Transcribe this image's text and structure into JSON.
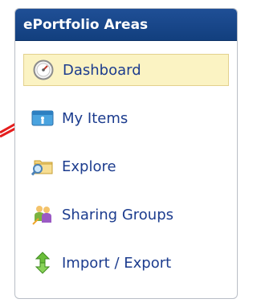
{
  "panel": {
    "title": "ePortfolio Areas"
  },
  "nav": {
    "items": [
      {
        "label": "Dashboard",
        "icon": "dashboard-gauge-icon",
        "active": true
      },
      {
        "label": "My Items",
        "icon": "my-items-id-card-icon",
        "active": false
      },
      {
        "label": "Explore",
        "icon": "explore-folder-magnifier-icon",
        "active": false
      },
      {
        "label": "Sharing Groups",
        "icon": "sharing-groups-people-icon",
        "active": false
      },
      {
        "label": "Import / Export",
        "icon": "import-export-arrows-icon",
        "active": false
      }
    ]
  },
  "colors": {
    "header_bg": "#1f4f96",
    "active_bg": "#fbf3c3",
    "link": "#1c3c8e",
    "annotation_arrow": "#e51d1d"
  }
}
